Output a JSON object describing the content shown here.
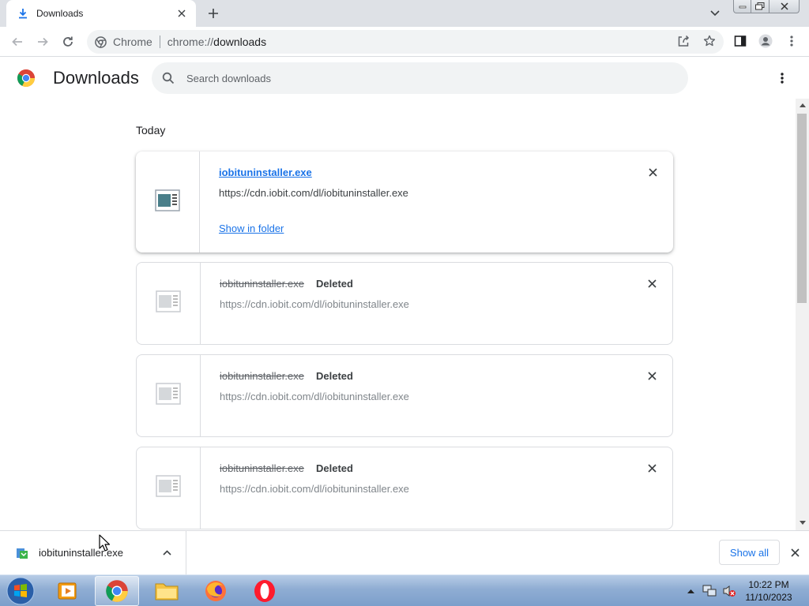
{
  "browser": {
    "tab": {
      "title": "Downloads",
      "icon": "download-icon"
    },
    "toolbar": {
      "chip_label": "Chrome",
      "url_scheme": "chrome://",
      "url_host": "downloads"
    }
  },
  "downloads_page": {
    "title": "Downloads",
    "search_placeholder": "Search downloads",
    "section_title": "Today",
    "items": [
      {
        "file_name": "iobituninstaller.exe",
        "url": "https://cdn.iobit.com/dl/iobituninstaller.exe",
        "status": "",
        "action": "Show in folder",
        "state": "completed"
      },
      {
        "file_name": "iobituninstaller.exe",
        "url": "https://cdn.iobit.com/dl/iobituninstaller.exe",
        "status": "Deleted",
        "state": "deleted"
      },
      {
        "file_name": "iobituninstaller.exe",
        "url": "https://cdn.iobit.com/dl/iobituninstaller.exe",
        "status": "Deleted",
        "state": "deleted"
      },
      {
        "file_name": "iobituninstaller.exe",
        "url": "https://cdn.iobit.com/dl/iobituninstaller.exe",
        "status": "Deleted",
        "state": "deleted"
      }
    ]
  },
  "download_shelf": {
    "file_name": "iobituninstaller.exe",
    "show_all_label": "Show all"
  },
  "taskbar": {
    "apps": [
      "windows-media-player",
      "chrome",
      "file-explorer",
      "firefox",
      "opera"
    ],
    "active_app": "chrome",
    "clock_time": "10:22 PM",
    "clock_date": "11/10/2023"
  },
  "colors": {
    "link_blue": "#1a73e8",
    "tabstrip_bg": "#dee1e6",
    "omnibox_bg": "#f1f3f4"
  }
}
